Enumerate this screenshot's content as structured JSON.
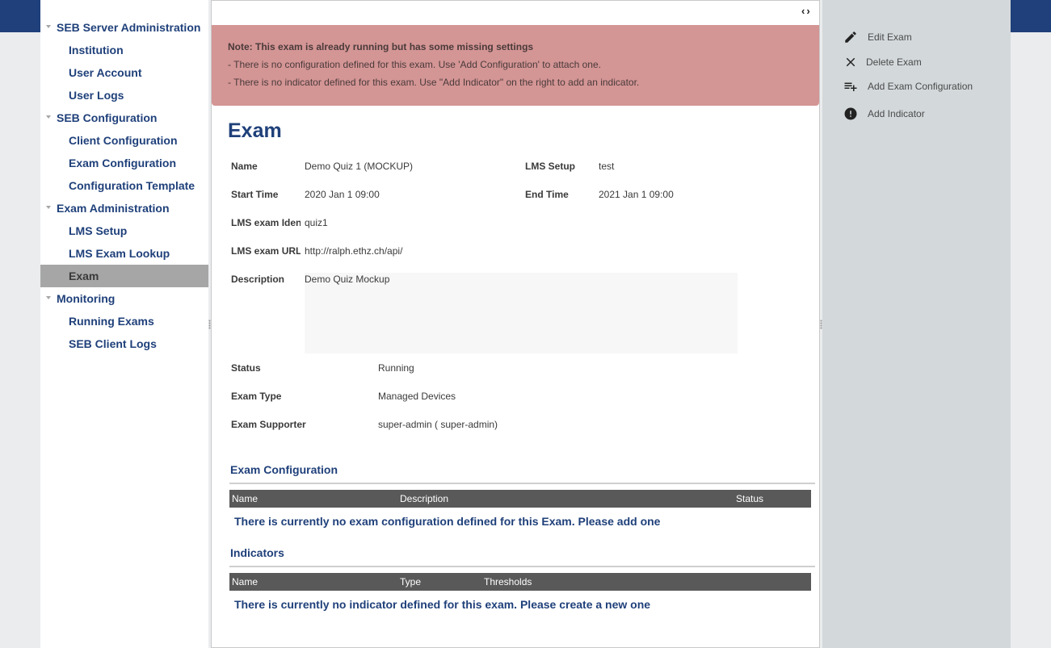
{
  "navigation": {
    "sections": [
      {
        "label": "SEB Server Administration",
        "items": [
          "Institution",
          "User Account",
          "User Logs"
        ]
      },
      {
        "label": "SEB Configuration",
        "items": [
          "Client Configuration",
          "Exam Configuration",
          "Configuration Template"
        ]
      },
      {
        "label": "Exam Administration",
        "items": [
          "LMS Setup",
          "LMS Exam Lookup",
          "Exam"
        ]
      },
      {
        "label": "Monitoring",
        "items": [
          "Running Exams",
          "SEB Client Logs"
        ]
      }
    ],
    "active_item": "Exam"
  },
  "warning": {
    "title": "Note: This exam is already running but has some missing settings",
    "lines": [
      "- There is no configuration defined for this exam. Use 'Add Configuration' to attach one.",
      "- There is no indicator defined for this exam. Use \"Add Indicator\" on the right to add an indicator."
    ]
  },
  "page_title": "Exam",
  "form": {
    "name": {
      "label": "Name",
      "value": "Demo Quiz 1 (MOCKUP)"
    },
    "lms_setup": {
      "label": "LMS Setup",
      "value": "test"
    },
    "start_time": {
      "label": "Start Time",
      "value": "2020 Jan 1 09:00"
    },
    "end_time": {
      "label": "End Time",
      "value": "2021 Jan 1 09:00"
    },
    "lms_exam_id": {
      "label": "LMS exam Identifier",
      "value": "quiz1"
    },
    "lms_exam_url": {
      "label": "LMS exam URL",
      "value": "http://ralph.ethz.ch/api/"
    },
    "description": {
      "label": "Description",
      "value": "Demo Quiz Mockup"
    },
    "status": {
      "label": "Status",
      "value": "Running"
    },
    "exam_type": {
      "label": "Exam Type",
      "value": "Managed Devices"
    },
    "exam_supporter": {
      "label": "Exam Supporter",
      "value": "super-admin ( super-admin)"
    }
  },
  "exam_configuration": {
    "title": "Exam Configuration",
    "columns": [
      "Name",
      "Description",
      "Status"
    ],
    "empty_message": "There is currently no exam configuration defined for this Exam. Please add one"
  },
  "indicators": {
    "title": "Indicators",
    "columns": [
      "Name",
      "Type",
      "Thresholds"
    ],
    "empty_message": "There is currently no indicator defined for this exam. Please create a new one"
  },
  "actions": [
    {
      "label": "Edit Exam",
      "icon": "edit-icon"
    },
    {
      "label": "Delete Exam",
      "icon": "close-icon"
    },
    {
      "label": "Add Exam Configuration",
      "icon": "playlist-add-icon"
    },
    {
      "label": "Add Indicator",
      "icon": "exclamation-circle-icon"
    }
  ],
  "colors": {
    "brand": "#1f407a",
    "warning_bg": "#d49595",
    "active_nav": "#a6a6a6",
    "table_header": "#595959",
    "action_panel": "#d3d8db"
  }
}
